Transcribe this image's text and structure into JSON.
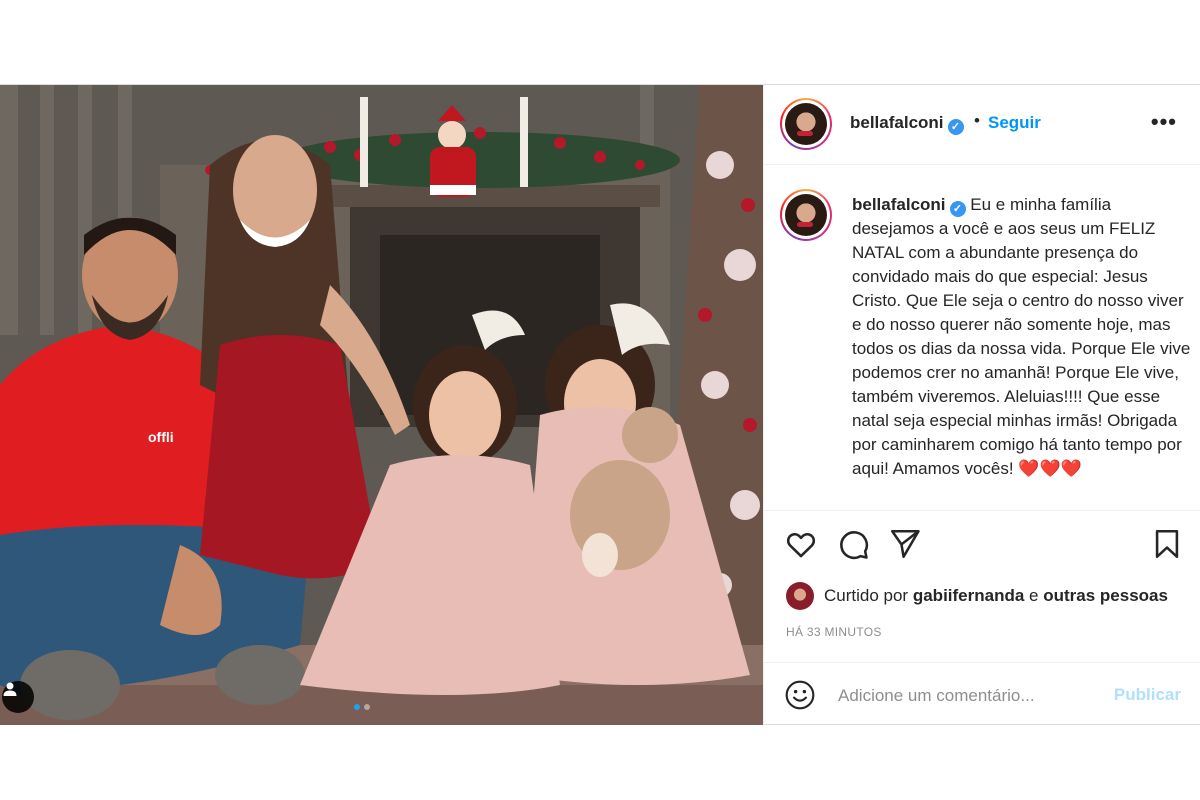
{
  "post": {
    "username": "bellafalconi",
    "verified_icon": "verified-badge-icon",
    "separator": "•",
    "follow_label": "Seguir",
    "more_label": "•••",
    "caption_username": "bellafalconi",
    "caption_text": "Eu e minha família desejamos a você e aos seus um FELIZ NATAL com a abundante presença do convidado mais do que especial: Jesus Cristo. Que Ele seja o centro do nosso viver e do nosso querer não somente hoje, mas todos os dias da nossa vida. Porque Ele vive podemos crer no amanhã! Porque Ele vive, também viveremos. Aleluias!!!! Que esse natal seja especial minhas irmãs! Obrigada por caminharem comigo há tanto tempo por aqui! Amamos vocês!",
    "caption_hearts": "❤️❤️❤️",
    "likes": {
      "prefix": "Curtido por",
      "user": "gabiifernanda",
      "conjunction": "e",
      "others": "outras pessoas"
    },
    "timestamp": "HÁ 33 MINUTOS",
    "comment_placeholder": "Adicione um comentário...",
    "publish_label": "Publicar",
    "carousel": {
      "total": 2,
      "current": 1
    },
    "photo_tag_text": "offli"
  },
  "colors": {
    "accent": "#0095f6",
    "verified": "#3897f0",
    "publish_disabled": "#b2dffc",
    "muted": "#8e8e8e",
    "heart": "#e0245e"
  }
}
